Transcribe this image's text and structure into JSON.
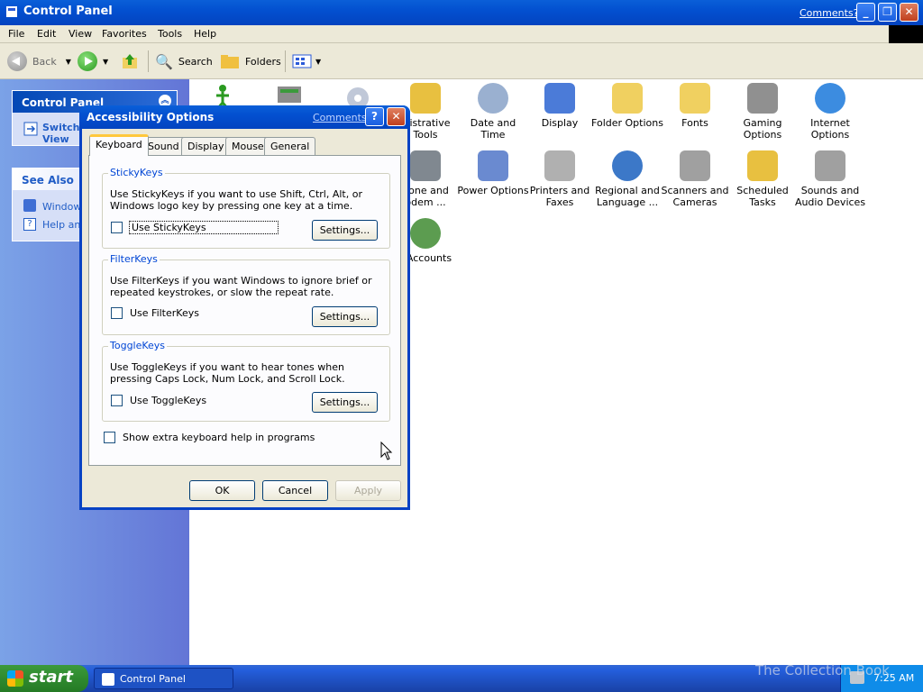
{
  "window": {
    "title": "Control Panel",
    "comments_link": "Comments?"
  },
  "menubar": {
    "items": [
      "File",
      "Edit",
      "View",
      "Favorites",
      "Tools",
      "Help"
    ]
  },
  "toolbar": {
    "back_label": "Back",
    "search_label": "Search",
    "folders_label": "Folders"
  },
  "leftpane": {
    "panel_title": "Control Panel",
    "switch_view": [
      "Switch",
      "View"
    ],
    "see_also_title": "See Also",
    "see_also_items": [
      "Windows",
      "Help and"
    ]
  },
  "icons": [
    {
      "label": "Administrative Tools",
      "visible": [
        "inistrative",
        "Tools"
      ],
      "color": "#e8c040"
    },
    {
      "label": "Date and Time",
      "visible": [
        "Date and Time"
      ],
      "color": "#9ab0d0"
    },
    {
      "label": "Display",
      "visible": [
        "Display"
      ],
      "color": "#4b7bd8"
    },
    {
      "label": "Folder Options",
      "visible": [
        "Folder Options"
      ],
      "color": "#f0d060"
    },
    {
      "label": "Fonts",
      "visible": [
        "Fonts"
      ],
      "color": "#f0d060"
    },
    {
      "label": "Gaming Options",
      "visible": [
        "Gaming",
        "Options"
      ],
      "color": "#909090"
    },
    {
      "label": "Internet Options",
      "visible": [
        "Internet",
        "Options"
      ],
      "color": "#3c8ce0"
    },
    {
      "label": "Phone and Modem Options",
      "visible": [
        "hone and",
        "odem ..."
      ],
      "color": "#808890"
    },
    {
      "label": "Power Options",
      "visible": [
        "Power Options"
      ],
      "color": "#6a8ad0"
    },
    {
      "label": "Printers and Faxes",
      "visible": [
        "Printers and",
        "Faxes"
      ],
      "color": "#b0b0b0"
    },
    {
      "label": "Regional and Language Options",
      "visible": [
        "Regional and",
        "Language ..."
      ],
      "color": "#3c78c8"
    },
    {
      "label": "Scanners and Cameras",
      "visible": [
        "Scanners and",
        "Cameras"
      ],
      "color": "#a0a0a0"
    },
    {
      "label": "Scheduled Tasks",
      "visible": [
        "Scheduled",
        "Tasks"
      ],
      "color": "#e8c040"
    },
    {
      "label": "Sounds and Audio Devices",
      "visible": [
        "Sounds and",
        "Audio Devices"
      ],
      "color": "#a0a0a0"
    },
    {
      "label": "User Accounts",
      "visible": [
        "r Accounts"
      ],
      "color": "#5c9c50"
    }
  ],
  "dialog": {
    "title": "Accessibility Options",
    "comments": "Comments?",
    "tabs": [
      "Keyboard",
      "Sound",
      "Display",
      "Mouse",
      "General"
    ],
    "active_tab": "Keyboard",
    "groups": [
      {
        "label": "StickyKeys",
        "text": "Use StickyKeys if you want to use Shift, Ctrl, Alt, or Windows logo key by pressing one key at a time.",
        "checkbox": "Use StickyKeys",
        "settings": "Settings..."
      },
      {
        "label": "FilterKeys",
        "text": "Use FilterKeys if you want Windows to ignore brief or repeated keystrokes, or slow the repeat rate.",
        "checkbox": "Use FilterKeys",
        "settings": "Settings..."
      },
      {
        "label": "ToggleKeys",
        "text": "Use ToggleKeys if you want to hear tones when pressing Caps Lock, Num Lock, and Scroll Lock.",
        "checkbox": "Use ToggleKeys",
        "settings": "Settings..."
      }
    ],
    "extra_checkbox": "Show extra keyboard help in programs",
    "buttons": {
      "ok": "OK",
      "cancel": "Cancel",
      "apply": "Apply"
    }
  },
  "taskbar": {
    "start": "start",
    "task": "Control Panel",
    "time": "7:25 AM"
  },
  "watermark": "The Collection Book"
}
